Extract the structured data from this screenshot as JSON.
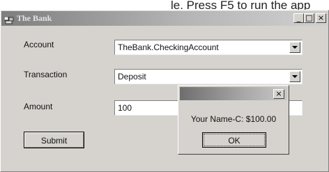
{
  "caption": "le. Press F5 to run the app",
  "window": {
    "title": "The Bank",
    "controls": {
      "minimize": "_",
      "maximize": "□",
      "close": "×"
    }
  },
  "form": {
    "account_label": "Account",
    "account_value": "TheBank.CheckingAccount",
    "transaction_label": "Transaction",
    "transaction_value": "Deposit",
    "amount_label": "Amount",
    "amount_value": "100",
    "submit_label": "Submit"
  },
  "dialog": {
    "close": "×",
    "message": "Your Name-C: $100.00",
    "ok_label": "OK"
  },
  "colors": {
    "window_face": "#d6d3ce",
    "titlebar_inactive": "#7e7e7e"
  }
}
